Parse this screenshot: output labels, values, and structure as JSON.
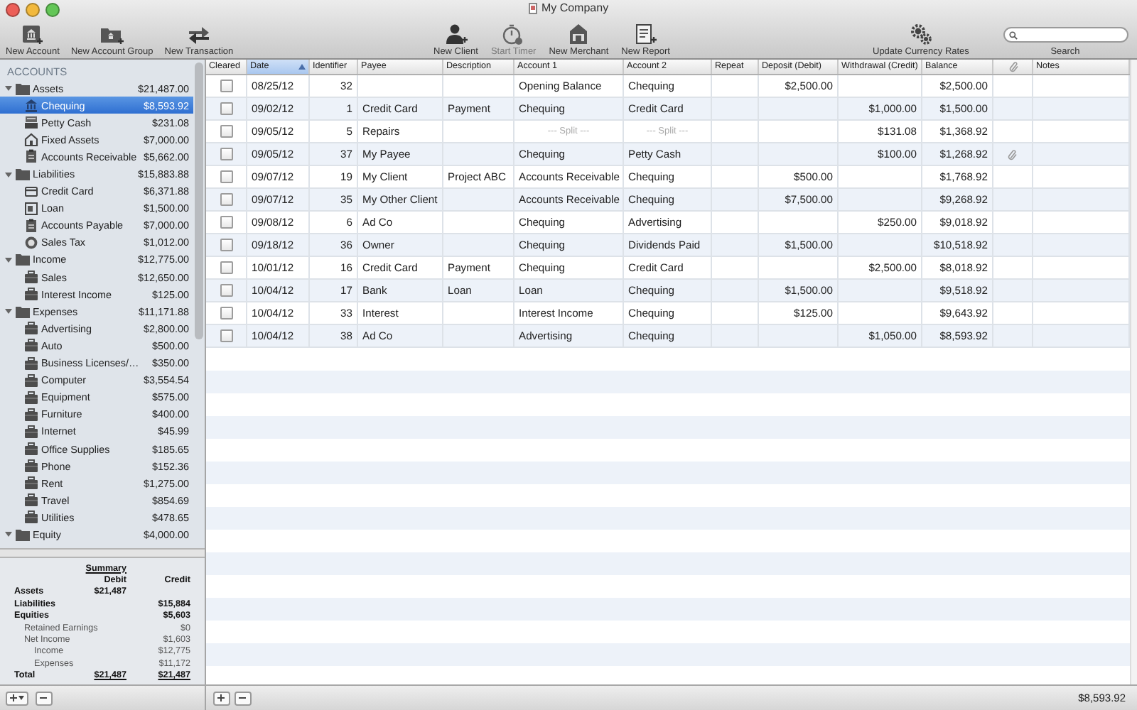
{
  "window": {
    "title": "My Company"
  },
  "toolbar": {
    "left": [
      {
        "kind": "account",
        "label": "New Account",
        "disabled": false
      },
      {
        "kind": "group",
        "label": "New Account Group",
        "disabled": false
      },
      {
        "kind": "transaction",
        "label": "New Transaction",
        "disabled": false
      }
    ],
    "center": [
      {
        "kind": "client",
        "label": "New Client",
        "disabled": false
      },
      {
        "kind": "timer",
        "label": "Start Timer",
        "disabled": true
      },
      {
        "kind": "merchant",
        "label": "New Merchant",
        "disabled": false
      },
      {
        "kind": "report",
        "label": "New Report",
        "disabled": false
      }
    ],
    "right": [
      {
        "kind": "currency",
        "label": "Update Currency Rates",
        "disabled": false
      }
    ],
    "search": {
      "label": "Search"
    }
  },
  "sidebar": {
    "heading": "ACCOUNTS",
    "groups": [
      {
        "name": "Assets",
        "amount": "$21,487.00",
        "expanded": true,
        "children": [
          {
            "kind": "bank",
            "name": "Chequing",
            "amount": "$8,593.92",
            "selected": true
          },
          {
            "kind": "cash",
            "name": "Petty Cash",
            "amount": "$231.08",
            "selected": false
          },
          {
            "kind": "asset",
            "name": "Fixed Assets",
            "amount": "$7,000.00",
            "selected": false
          },
          {
            "kind": "ledger",
            "name": "Accounts Receivable",
            "amount": "$5,662.00",
            "selected": false
          }
        ]
      },
      {
        "name": "Liabilities",
        "amount": "$15,883.88",
        "expanded": true,
        "children": [
          {
            "kind": "card",
            "name": "Credit Card",
            "amount": "$6,371.88",
            "selected": false
          },
          {
            "kind": "loan",
            "name": "Loan",
            "amount": "$1,500.00",
            "selected": false
          },
          {
            "kind": "ledger",
            "name": "Accounts Payable",
            "amount": "$7,000.00",
            "selected": false
          },
          {
            "kind": "tax",
            "name": "Sales Tax",
            "amount": "$1,012.00",
            "selected": false
          }
        ]
      },
      {
        "name": "Income",
        "amount": "$12,775.00",
        "expanded": true,
        "children": [
          {
            "kind": "category",
            "name": "Sales",
            "amount": "$12,650.00",
            "selected": false
          },
          {
            "kind": "category",
            "name": "Interest Income",
            "amount": "$125.00",
            "selected": false
          }
        ]
      },
      {
        "name": "Expenses",
        "amount": "$11,171.88",
        "expanded": true,
        "children": [
          {
            "kind": "category",
            "name": "Advertising",
            "amount": "$2,800.00",
            "selected": false
          },
          {
            "kind": "category",
            "name": "Auto",
            "amount": "$500.00",
            "selected": false
          },
          {
            "kind": "category",
            "name": "Business Licenses/…",
            "amount": "$350.00",
            "selected": false
          },
          {
            "kind": "category",
            "name": "Computer",
            "amount": "$3,554.54",
            "selected": false
          },
          {
            "kind": "category",
            "name": "Equipment",
            "amount": "$575.00",
            "selected": false
          },
          {
            "kind": "category",
            "name": "Furniture",
            "amount": "$400.00",
            "selected": false
          },
          {
            "kind": "category",
            "name": "Internet",
            "amount": "$45.99",
            "selected": false
          },
          {
            "kind": "category",
            "name": "Office Supplies",
            "amount": "$185.65",
            "selected": false
          },
          {
            "kind": "category",
            "name": "Phone",
            "amount": "$152.36",
            "selected": false
          },
          {
            "kind": "category",
            "name": "Rent",
            "amount": "$1,275.00",
            "selected": false
          },
          {
            "kind": "category",
            "name": "Travel",
            "amount": "$854.69",
            "selected": false
          },
          {
            "kind": "category",
            "name": "Utilities",
            "amount": "$478.65",
            "selected": false
          }
        ]
      },
      {
        "name": "Equity",
        "amount": "$4,000.00",
        "expanded": true
      }
    ]
  },
  "summary": {
    "title": "Summary",
    "debit_label": "Debit",
    "credit_label": "Credit",
    "rows": [
      {
        "label": "Assets",
        "debit": "$21,487"
      },
      {
        "label": "Liabilities",
        "credit": "$15,884"
      },
      {
        "label": "Equities",
        "credit": "$5,603",
        "children": [
          {
            "label": "Retained Earnings",
            "credit": "$0"
          },
          {
            "label": "Net Income",
            "credit": "$1,603",
            "children": [
              {
                "label": "Income",
                "credit": "$12,775"
              },
              {
                "label": "Expenses",
                "credit": "$11,172"
              }
            ]
          }
        ]
      }
    ],
    "total": {
      "label": "Total",
      "debit": "$21,487",
      "credit": "$21,487"
    }
  },
  "table": {
    "columns": [
      {
        "kind": "text",
        "label": "Cleared",
        "sorted": false
      },
      {
        "kind": "text",
        "label": "Date",
        "sorted": true
      },
      {
        "kind": "text",
        "label": "Identifier",
        "sorted": false
      },
      {
        "kind": "text",
        "label": "Payee",
        "sorted": false
      },
      {
        "kind": "text",
        "label": "Description",
        "sorted": false
      },
      {
        "kind": "text",
        "label": "Account 1",
        "sorted": false
      },
      {
        "kind": "text",
        "label": "Account 2",
        "sorted": false
      },
      {
        "kind": "text",
        "label": "Repeat",
        "sorted": false
      },
      {
        "kind": "text",
        "label": "Deposit (Debit)",
        "sorted": false
      },
      {
        "kind": "text",
        "label": "Withdrawal (Credit)",
        "sorted": false
      },
      {
        "kind": "text",
        "label": "Balance",
        "sorted": false
      },
      {
        "kind": "attachment",
        "sorted": false
      },
      {
        "kind": "text",
        "label": "Notes",
        "sorted": false
      }
    ],
    "rows": [
      {
        "cleared": false,
        "date": "08/25/12",
        "id": "32",
        "account1": "Opening Balance",
        "account2": "Chequing",
        "deposit": "$2,500.00",
        "balance": "$2,500.00"
      },
      {
        "cleared": false,
        "date": "09/02/12",
        "id": "1",
        "payee": "Credit Card",
        "description": "Payment",
        "account1": "Chequing",
        "account2": "Credit Card",
        "withdrawal": "$1,000.00",
        "balance": "$1,500.00"
      },
      {
        "cleared": false,
        "date": "09/05/12",
        "id": "5",
        "payee": "Repairs",
        "split": true,
        "account1": "--- Split ---",
        "account2": "--- Split ---",
        "withdrawal": "$131.08",
        "balance": "$1,368.92"
      },
      {
        "cleared": false,
        "date": "09/05/12",
        "id": "37",
        "payee": "My Payee",
        "account1": "Chequing",
        "account2": "Petty Cash",
        "withdrawal": "$100.00",
        "balance": "$1,268.92",
        "attachment": true
      },
      {
        "cleared": false,
        "date": "09/07/12",
        "id": "19",
        "payee": "My Client",
        "description": "Project ABC",
        "account1": "Accounts Receivable",
        "account2": "Chequing",
        "deposit": "$500.00",
        "balance": "$1,768.92"
      },
      {
        "cleared": false,
        "date": "09/07/12",
        "id": "35",
        "payee": "My Other Client",
        "account1": "Accounts Receivable",
        "account2": "Chequing",
        "deposit": "$7,500.00",
        "balance": "$9,268.92"
      },
      {
        "cleared": false,
        "date": "09/08/12",
        "id": "6",
        "payee": "Ad Co",
        "account1": "Chequing",
        "account2": "Advertising",
        "withdrawal": "$250.00",
        "balance": "$9,018.92"
      },
      {
        "cleared": false,
        "date": "09/18/12",
        "id": "36",
        "payee": "Owner",
        "account1": "Chequing",
        "account2": "Dividends Paid",
        "deposit": "$1,500.00",
        "balance": "$10,518.92"
      },
      {
        "cleared": false,
        "date": "10/01/12",
        "id": "16",
        "payee": "Credit Card",
        "description": "Payment",
        "account1": "Chequing",
        "account2": "Credit Card",
        "withdrawal": "$2,500.00",
        "balance": "$8,018.92"
      },
      {
        "cleared": false,
        "date": "10/04/12",
        "id": "17",
        "payee": "Bank",
        "description": "Loan",
        "account1": "Loan",
        "account2": "Chequing",
        "deposit": "$1,500.00",
        "balance": "$9,518.92"
      },
      {
        "cleared": false,
        "date": "10/04/12",
        "id": "33",
        "payee": "Interest",
        "account1": "Interest Income",
        "account2": "Chequing",
        "deposit": "$125.00",
        "balance": "$9,643.92"
      },
      {
        "cleared": false,
        "date": "10/04/12",
        "id": "38",
        "payee": "Ad Co",
        "account1": "Advertising",
        "account2": "Chequing",
        "withdrawal": "$1,050.00",
        "balance": "$8,593.92"
      }
    ]
  },
  "status": {
    "balance": "$8,593.92"
  }
}
